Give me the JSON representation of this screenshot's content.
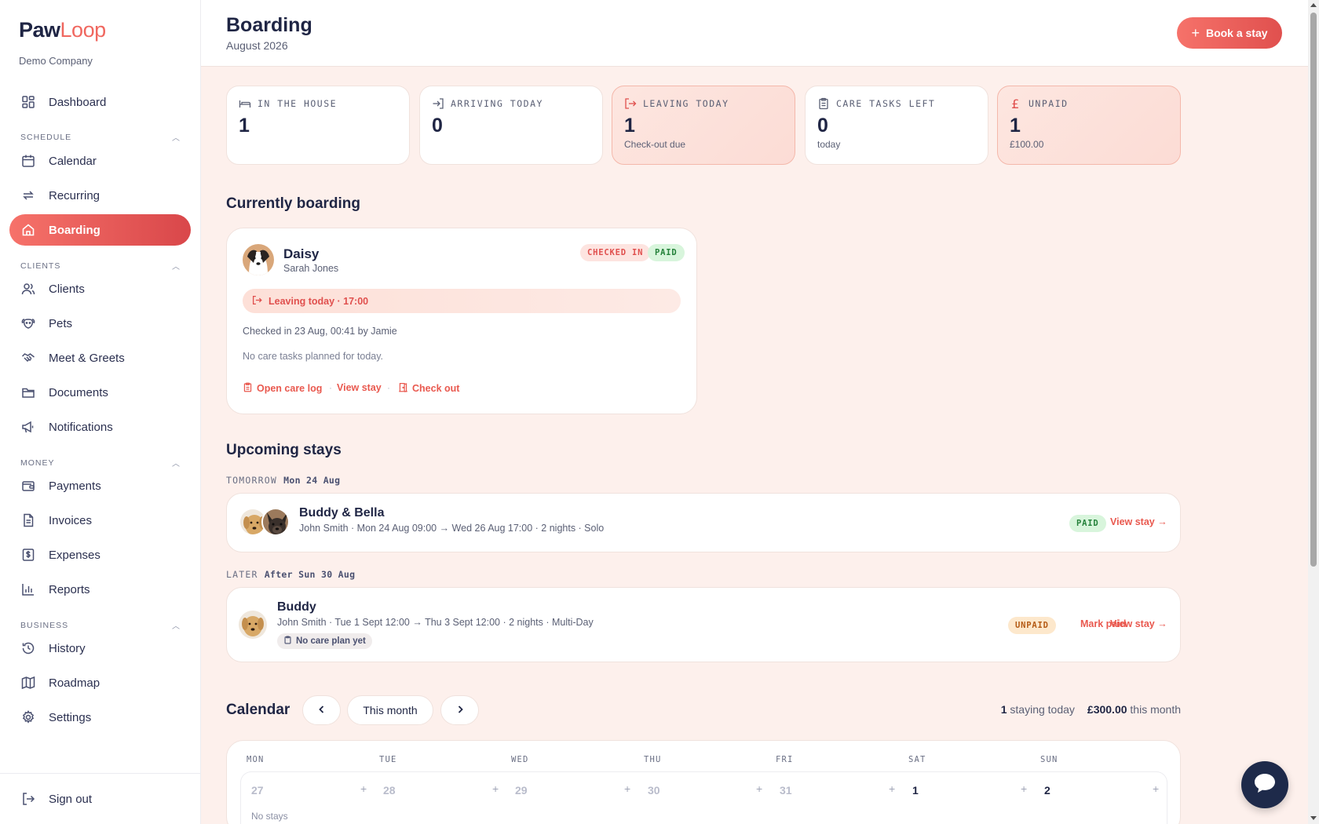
{
  "app": {
    "logo_paw": "Paw",
    "logo_loop": "Loop",
    "company": "Demo Company"
  },
  "sidebar": {
    "dashboard": "Dashboard",
    "sections": {
      "schedule": "SCHEDULE",
      "clients": "CLIENTS",
      "money": "MONEY",
      "business": "BUSINESS"
    },
    "items": {
      "calendar": "Calendar",
      "recurring": "Recurring",
      "boarding": "Boarding",
      "clients": "Clients",
      "pets": "Pets",
      "meet_greets": "Meet & Greets",
      "documents": "Documents",
      "notifications": "Notifications",
      "payments": "Payments",
      "invoices": "Invoices",
      "expenses": "Expenses",
      "reports": "Reports",
      "history": "History",
      "roadmap": "Roadmap",
      "settings": "Settings"
    },
    "sign_out": "Sign out",
    "active": "boarding"
  },
  "header": {
    "title": "Boarding",
    "subtitle": "August 2026",
    "book_button": "Book a stay"
  },
  "stats": [
    {
      "label": "IN THE HOUSE",
      "value": "1",
      "note": "",
      "icon": "bed-icon"
    },
    {
      "label": "ARRIVING TODAY",
      "value": "0",
      "note": "",
      "icon": "login-arrow-icon"
    },
    {
      "label": "LEAVING TODAY",
      "value": "1",
      "note": "Check-out due",
      "icon": "logout-arrow-icon"
    },
    {
      "label": "CARE TASKS LEFT",
      "value": "0",
      "note": "today",
      "icon": "clipboard-icon"
    },
    {
      "label": "UNPAID",
      "value": "1",
      "note": "£100.00",
      "icon": "pound-icon"
    }
  ],
  "currently_boarding": {
    "heading": "Currently boarding",
    "pet_name": "Daisy",
    "owner": "Sarah Jones",
    "badge_status": "CHECKED IN",
    "badge_payment": "PAID",
    "leaving": "Leaving today · 17:00",
    "checked_in": "Checked in 23 Aug, 00:41 by Jamie",
    "care_tasks": "No care tasks planned for today.",
    "actions": {
      "care_log": "Open care log",
      "view_stay": "View stay",
      "check_out": "Check out"
    }
  },
  "upcoming": {
    "heading": "Upcoming stays",
    "groups": [
      {
        "label": "TOMORROW",
        "date": "Mon 24 Aug",
        "stay": {
          "name": "Buddy & Bella",
          "meta": "John Smith · Mon 24 Aug 09:00 → Wed 26 Aug 17:00 · 2 nights · Solo",
          "badge": "PAID",
          "view": "View stay →"
        }
      },
      {
        "label": "LATER",
        "date": "After Sun 30 Aug",
        "stay": {
          "name": "Buddy",
          "meta": "John Smith · Tue 1 Sept 12:00 → Thu 3 Sept 12:00 · 2 nights · Multi-Day",
          "chip": "No care plan yet",
          "badge": "UNPAID",
          "mark_paid": "Mark paid",
          "view": "View stay →"
        }
      }
    ]
  },
  "calendar": {
    "heading": "Calendar",
    "this_month": "This month",
    "staying_count": "1",
    "staying_label": "staying today",
    "month_total": "£300.00",
    "month_label": "this month",
    "weekdays": [
      "MON",
      "TUE",
      "WED",
      "THU",
      "FRI",
      "SAT",
      "SUN"
    ],
    "days": [
      "27",
      "28",
      "29",
      "30",
      "31",
      "1",
      "2"
    ],
    "no_stays": "No stays"
  },
  "colors": {
    "accent": "#f0675f",
    "navy": "#1f2544",
    "page_bg": "#fdf0ec"
  }
}
